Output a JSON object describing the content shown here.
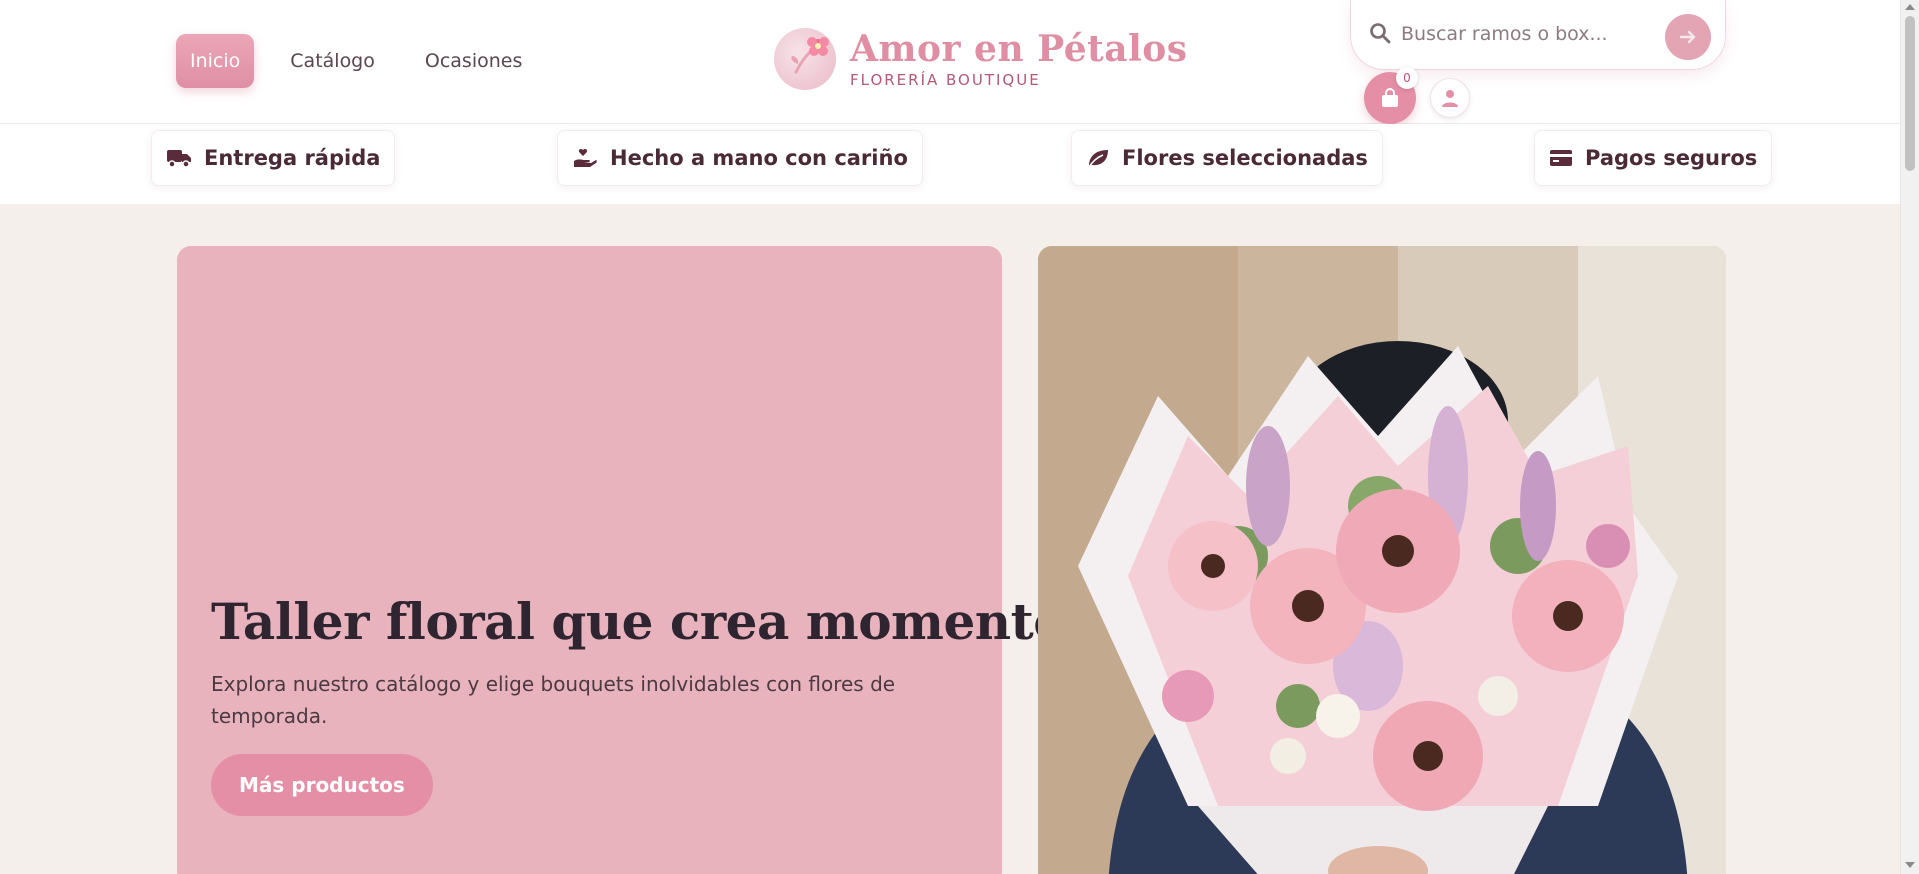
{
  "header": {
    "nav": [
      {
        "label": "Inicio"
      },
      {
        "label": "Catálogo"
      },
      {
        "label": "Ocasiones"
      }
    ],
    "brand": {
      "title": "Amor en Pétalos",
      "subtitle": "FLORERÍA BOUTIQUE"
    },
    "search": {
      "placeholder": "Buscar ramos o box..."
    },
    "cart": {
      "count": "0"
    }
  },
  "features": [
    {
      "label": "Entrega rápida",
      "icon": "truck-icon"
    },
    {
      "label": "Hecho a mano con cariño",
      "icon": "hand-heart-icon"
    },
    {
      "label": "Flores seleccionadas",
      "icon": "leaf-icon"
    },
    {
      "label": "Pagos seguros",
      "icon": "credit-card-icon"
    }
  ],
  "hero": {
    "title": "Taller floral que crea momentos",
    "text": "Explora nuestro catálogo y elige bouquets inolvidables con flores de temporada.",
    "button_label": "Más productos"
  },
  "colors": {
    "accent": "#e58fa6",
    "hero_card": "#e8b3bd",
    "brand_title": "#e08ea3",
    "page_bg": "#f4efea"
  }
}
